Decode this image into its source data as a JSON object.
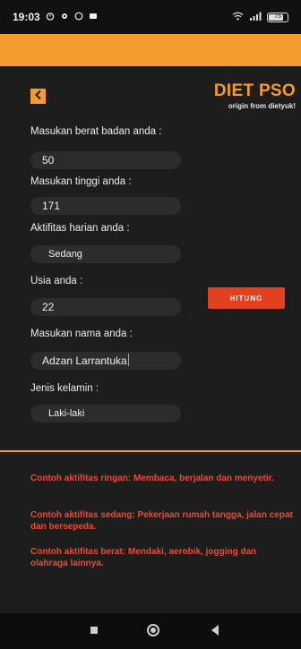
{
  "status_bar": {
    "time": "19:03",
    "battery": "75"
  },
  "header": {
    "title": "DIET PSO",
    "subtitle": "origin from dietyuk!"
  },
  "form": {
    "weight_label": "Masukan berat badan anda :",
    "weight_value": "50",
    "height_label": "Masukan tinggi anda :",
    "height_value": "171",
    "activity_label": "Aktifitas harian anda :",
    "activity_value": "Sedang",
    "age_label": "Usia anda :",
    "age_value": "22",
    "name_label": "Masukan nama anda :",
    "name_value": "Adzan Larrantuka",
    "gender_label": "Jenis kelamin :",
    "gender_value": "Laki-laki"
  },
  "actions": {
    "calculate_label": "HITUNG"
  },
  "notes": {
    "light": "Contoh aktifitas ringan: Membaca, berjalan dan menyetir.",
    "medium": "Contoh aktifitas sedang: Pekerjaan rumah tangga, jalan cepat dan bersepeda.",
    "heavy": "Contoh aktifitas berat: Mendaki, aerobik, jogging dan olahraga lainnya."
  },
  "colors": {
    "accent": "#f49b2d",
    "button": "#e1411f",
    "note_text": "#e84c36",
    "background": "#1d1d1d"
  },
  "icons": {
    "back": "chevron-left-icon",
    "nav_recents": "square-icon",
    "nav_home": "circle-icon",
    "nav_back": "triangle-back-icon"
  }
}
